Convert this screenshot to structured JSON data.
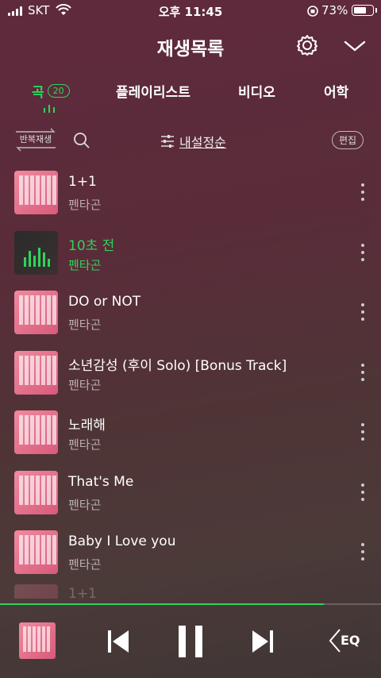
{
  "status_bar": {
    "carrier": "SKT",
    "time": "오후 11:45",
    "battery_percent_label": "73%",
    "battery_level": 0.73
  },
  "header": {
    "title": "재생목록"
  },
  "tabs": [
    {
      "label": "곡",
      "count": "20",
      "active": true
    },
    {
      "label": "플레이리스트"
    },
    {
      "label": "비디오"
    },
    {
      "label": "어학"
    }
  ],
  "toolbar": {
    "repeat_label": "반복재생",
    "sort_label": "내설정순",
    "edit_label": "편집"
  },
  "songs": [
    {
      "title": "1+1",
      "artist": "펜타곤"
    },
    {
      "title": "10초 전",
      "artist": "펜타곤",
      "playing": true
    },
    {
      "title": "DO or NOT",
      "artist": "펜타곤"
    },
    {
      "title": "소년감성 (후이 Solo) [Bonus Track]",
      "artist": "펜타곤"
    },
    {
      "title": "노래해",
      "artist": "펜타곤"
    },
    {
      "title": "That's Me",
      "artist": "펜타곤"
    },
    {
      "title": "Baby I Love you",
      "artist": "펜타곤"
    },
    {
      "title": "1+1",
      "artist": ""
    }
  ],
  "player": {
    "progress": 0.85
  },
  "colors": {
    "accent": "#2fd35a"
  },
  "player_controls": {
    "eq_label": "EQ"
  }
}
